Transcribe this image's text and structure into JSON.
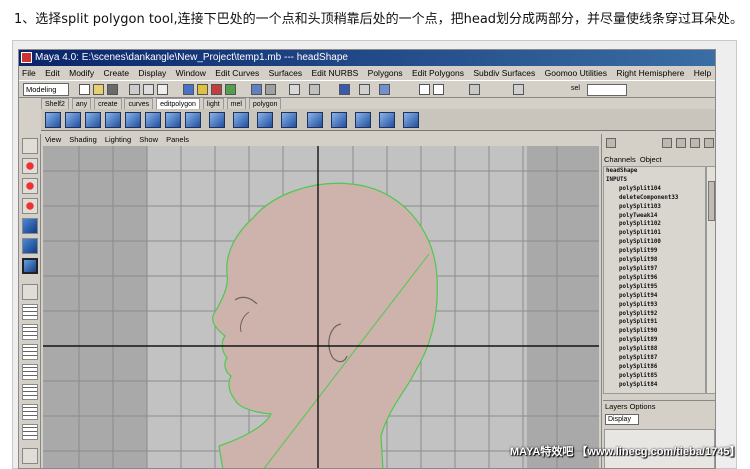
{
  "caption": "1、选择split polygon tool,连接下巴处的一个点和头顶稍靠后处的一个点，把head划分成两部分，并尽量使线条穿过耳朵处。",
  "window": {
    "title": "Maya 4.0: E:\\scenes\\dankangle\\New_Project\\temp1.mb  ---  headShape"
  },
  "menu": [
    "File",
    "Edit",
    "Modify",
    "Create",
    "Display",
    "Window",
    "Edit Curves",
    "Surfaces",
    "Edit NURBS",
    "Polygons",
    "Edit Polygons",
    "Subdiv Surfaces",
    "Goomoo Utilities",
    "Right Hemisphere",
    "Help"
  ],
  "status": {
    "mode": "Modeling",
    "sel_label": "sel"
  },
  "shelf_tabs": [
    "Shelf2",
    "any",
    "create",
    "curves",
    "editpolygon",
    "light",
    "mel",
    "polygon"
  ],
  "shelf_active": "editpolygon",
  "panel_menu": [
    "View",
    "Shading",
    "Lighting",
    "Show",
    "Panels"
  ],
  "channel_box": {
    "tabs": [
      "Channels",
      "Object"
    ],
    "node": "headShape",
    "inputs_label": "INPUTS",
    "inputs": [
      "polySplit104",
      "deleteComponent33",
      "polySplit103",
      "polyTweak14",
      "polySplit102",
      "polySplit101",
      "polySplit100",
      "polySplit99",
      "polySplit98",
      "polySplit97",
      "polySplit96",
      "polySplit95",
      "polySplit94",
      "polySplit93",
      "polySplit92",
      "polySplit91",
      "polySplit90",
      "polySplit89",
      "polySplit88",
      "polySplit87",
      "polySplit86",
      "polySplit85",
      "polySplit84"
    ]
  },
  "layers": {
    "title": "Layers  Options",
    "dropdown": "Display"
  },
  "watermark": "MAYA特效吧 【www.linecg.com/tieba/1745】",
  "colors": {
    "viewport_bg": "#a9a9a9",
    "head_fill": "#cdb3ab",
    "wire": "#4ec94e",
    "axis": "#141414"
  }
}
